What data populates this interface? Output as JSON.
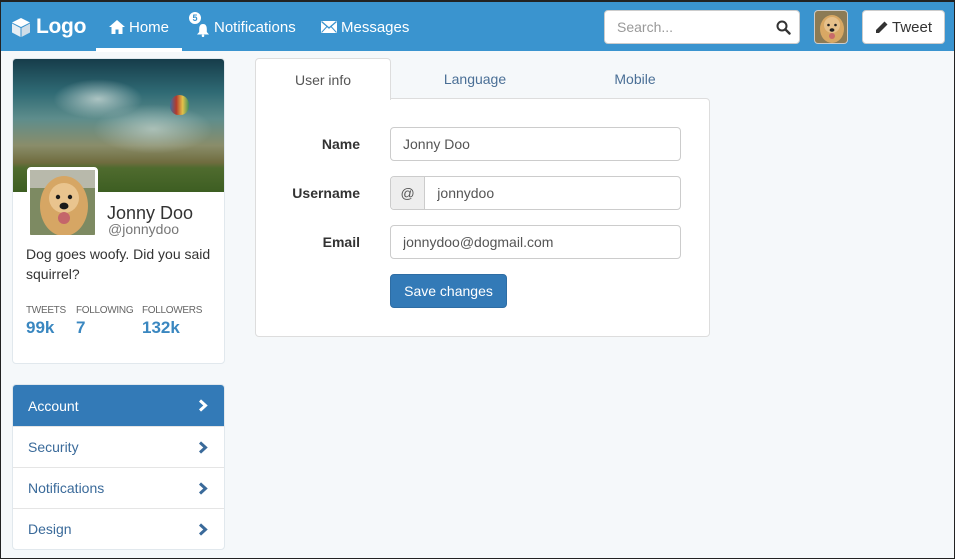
{
  "navbar": {
    "logo": "Logo",
    "items": [
      {
        "label": "Home",
        "icon": "home-icon",
        "active": true
      },
      {
        "label": "Notifications",
        "icon": "bell-icon",
        "badge": "5"
      },
      {
        "label": "Messages",
        "icon": "envelope-icon"
      }
    ],
    "search_placeholder": "Search...",
    "tweet_label": "Tweet"
  },
  "profile": {
    "name": "Jonny Doo",
    "handle": "@jonnydoo",
    "bio": "Dog goes woofy. Did you said squirrel?",
    "stats": [
      {
        "label": "TWEETS",
        "value": "99k"
      },
      {
        "label": "FOLLOWING",
        "value": "7"
      },
      {
        "label": "FOLLOWERS",
        "value": "132k"
      }
    ]
  },
  "side_menu": {
    "items": [
      {
        "label": "Account",
        "active": true
      },
      {
        "label": "Security"
      },
      {
        "label": "Notifications"
      },
      {
        "label": "Design"
      }
    ]
  },
  "tabs": [
    {
      "label": "User info",
      "active": true
    },
    {
      "label": "Language"
    },
    {
      "label": "Mobile"
    }
  ],
  "form": {
    "name_label": "Name",
    "name_value": "Jonny Doo",
    "username_label": "Username",
    "username_addon": "@",
    "username_value": "jonnydoo",
    "email_label": "Email",
    "email_value": "jonnydoo@dogmail.com",
    "save_label": "Save changes"
  },
  "colors": {
    "navbar": "#3a94cf",
    "primary": "#337ab7",
    "stat_value": "#3a87c0",
    "background": "#f5f8fa"
  }
}
